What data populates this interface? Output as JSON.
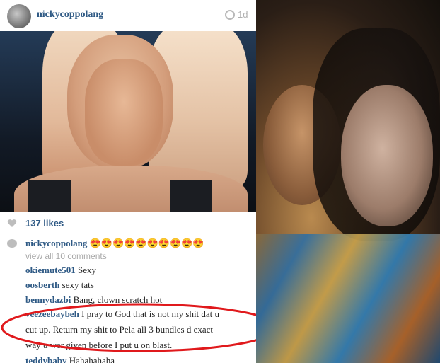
{
  "post": {
    "username": "nickycoppolang",
    "age": "1d",
    "likes": "137 likes"
  },
  "caption": {
    "username": "nickycoppolang",
    "emojis": "😍😍😍😍😍😍😍😍😍😍"
  },
  "view_all": "view all 10 comments",
  "comments": [
    {
      "user": "okiemute501",
      "text": "Sexy"
    },
    {
      "user": "oosberth",
      "text": "sexy tats"
    },
    {
      "user": "bennydazbi",
      "text": "Bang, clown scratch hot"
    },
    {
      "user": "veezeebaybeh",
      "text": "I pray to God that is not my shit dat u",
      "cont1": "cut up. Return my shit to Pela all 3 bundles d exact",
      "cont2": "way u wer given before I put u on blast."
    },
    {
      "user": "teddybaby",
      "text": "Hahahahaha"
    }
  ],
  "colors": {
    "username": "#2f5a85",
    "annotation_oval": "#e0191c",
    "meta_gray": "#a9a9a9"
  },
  "photo_watermark": "nickycoppolang"
}
